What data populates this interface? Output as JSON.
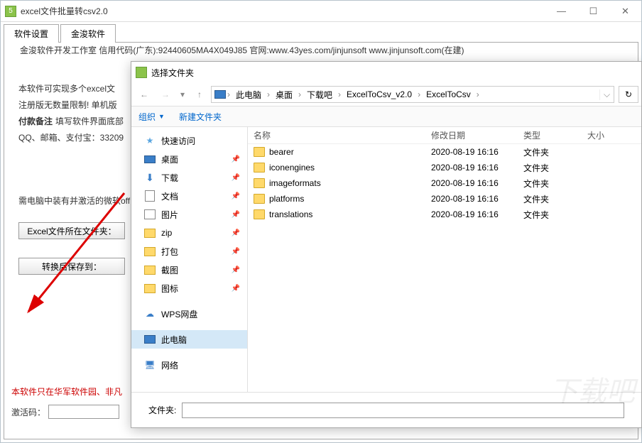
{
  "parent": {
    "title": "excel文件批量转csv2.0",
    "tabs": [
      "软件设置",
      "金浚软件"
    ],
    "group_title": "金浚软件开发工作室 信用代码(广东):92440605MA4X049J85 官网:www.43yes.com/jinjunsoft  www.jinjunsoft.com(在建)",
    "lines": {
      "l1": "本软件可实现多个excel文",
      "l2": "注册版无数量限制! 单机版",
      "l3a": "付款备注",
      "l3b": "填写软件界面底部",
      "l4": "QQ、邮箱、支付宝：33209",
      "l5": "需电脑中装有并激活的微软off",
      "btn1": "Excel文件所在文件夹：",
      "btn2": "转换后保存到：",
      "footer1": "本软件只在华军软件园、非凡",
      "act_label": "激活码："
    }
  },
  "dialog": {
    "title": "选择文件夹",
    "path": [
      "此电脑",
      "桌面",
      "下载吧",
      "ExcelToCsv_v2.0",
      "ExcelToCsv"
    ],
    "toolbar": {
      "organize": "组织",
      "new_folder": "新建文件夹"
    },
    "sidebar": [
      {
        "label": "快速访问",
        "icon": "star",
        "pin": false
      },
      {
        "label": "桌面",
        "icon": "desktop",
        "pin": true
      },
      {
        "label": "下载",
        "icon": "download",
        "pin": true
      },
      {
        "label": "文档",
        "icon": "doc",
        "pin": true
      },
      {
        "label": "图片",
        "icon": "pic",
        "pin": true
      },
      {
        "label": "zip",
        "icon": "folder",
        "pin": true
      },
      {
        "label": "打包",
        "icon": "folder",
        "pin": true
      },
      {
        "label": "截图",
        "icon": "folder",
        "pin": true
      },
      {
        "label": "图标",
        "icon": "folder",
        "pin": true
      },
      {
        "label": "WPS网盘",
        "icon": "cloud",
        "pin": false,
        "gap": true
      },
      {
        "label": "此电脑",
        "icon": "pc",
        "pin": false,
        "selected": true,
        "gap": true
      },
      {
        "label": "网络",
        "icon": "net",
        "pin": false,
        "gap": true
      }
    ],
    "columns": {
      "name": "名称",
      "date": "修改日期",
      "type": "类型",
      "size": "大小"
    },
    "rows": [
      {
        "name": "bearer",
        "date": "2020-08-19 16:16",
        "type": "文件夹"
      },
      {
        "name": "iconengines",
        "date": "2020-08-19 16:16",
        "type": "文件夹"
      },
      {
        "name": "imageformats",
        "date": "2020-08-19 16:16",
        "type": "文件夹"
      },
      {
        "name": "platforms",
        "date": "2020-08-19 16:16",
        "type": "文件夹"
      },
      {
        "name": "translations",
        "date": "2020-08-19 16:16",
        "type": "文件夹"
      }
    ],
    "footer_label": "文件夹:"
  }
}
